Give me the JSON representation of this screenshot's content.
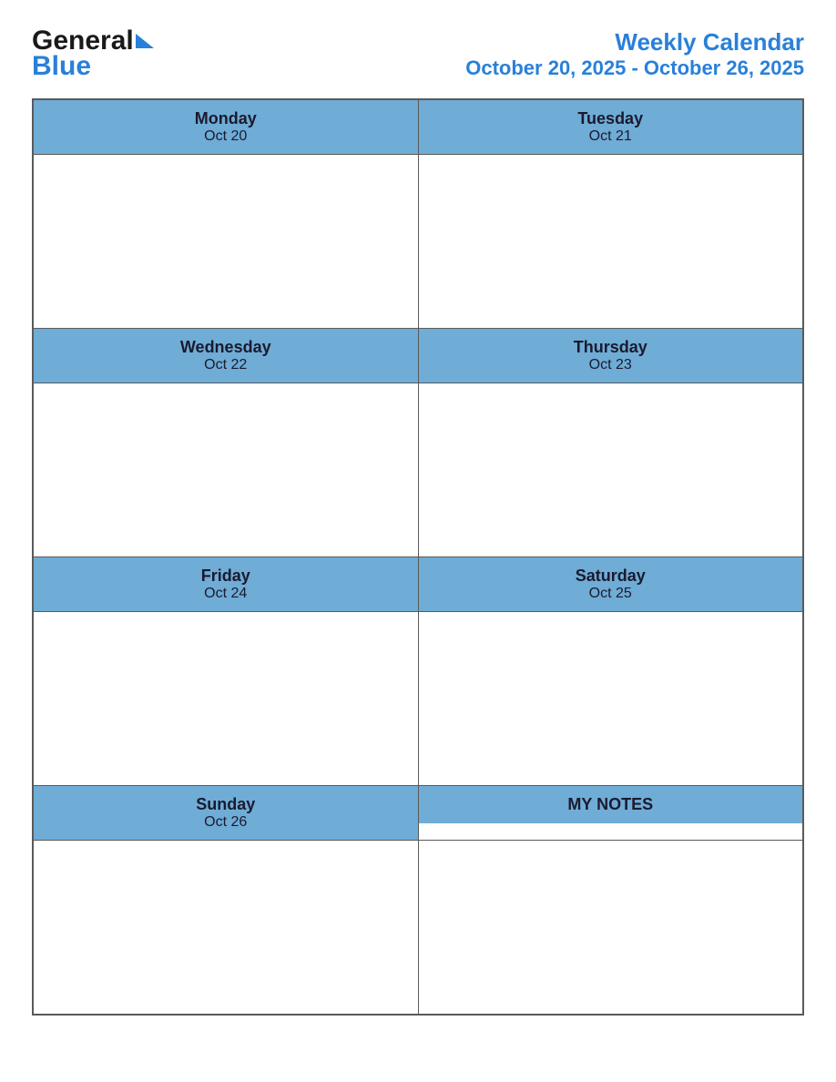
{
  "header": {
    "logo": {
      "general": "General",
      "blue": "Blue",
      "triangle_color": "#2980d9"
    },
    "title": {
      "main": "Weekly Calendar",
      "sub": "October 20, 2025 - October 26, 2025"
    }
  },
  "calendar": {
    "accent_color": "#6facd6",
    "text_color": "#1a1a2e",
    "days": [
      {
        "name": "Monday",
        "date": "Oct 20"
      },
      {
        "name": "Tuesday",
        "date": "Oct 21"
      },
      {
        "name": "Wednesday",
        "date": "Oct 22"
      },
      {
        "name": "Thursday",
        "date": "Oct 23"
      },
      {
        "name": "Friday",
        "date": "Oct 24"
      },
      {
        "name": "Saturday",
        "date": "Oct 25"
      },
      {
        "name": "Sunday",
        "date": "Oct 26"
      }
    ],
    "notes_label": "MY NOTES"
  }
}
